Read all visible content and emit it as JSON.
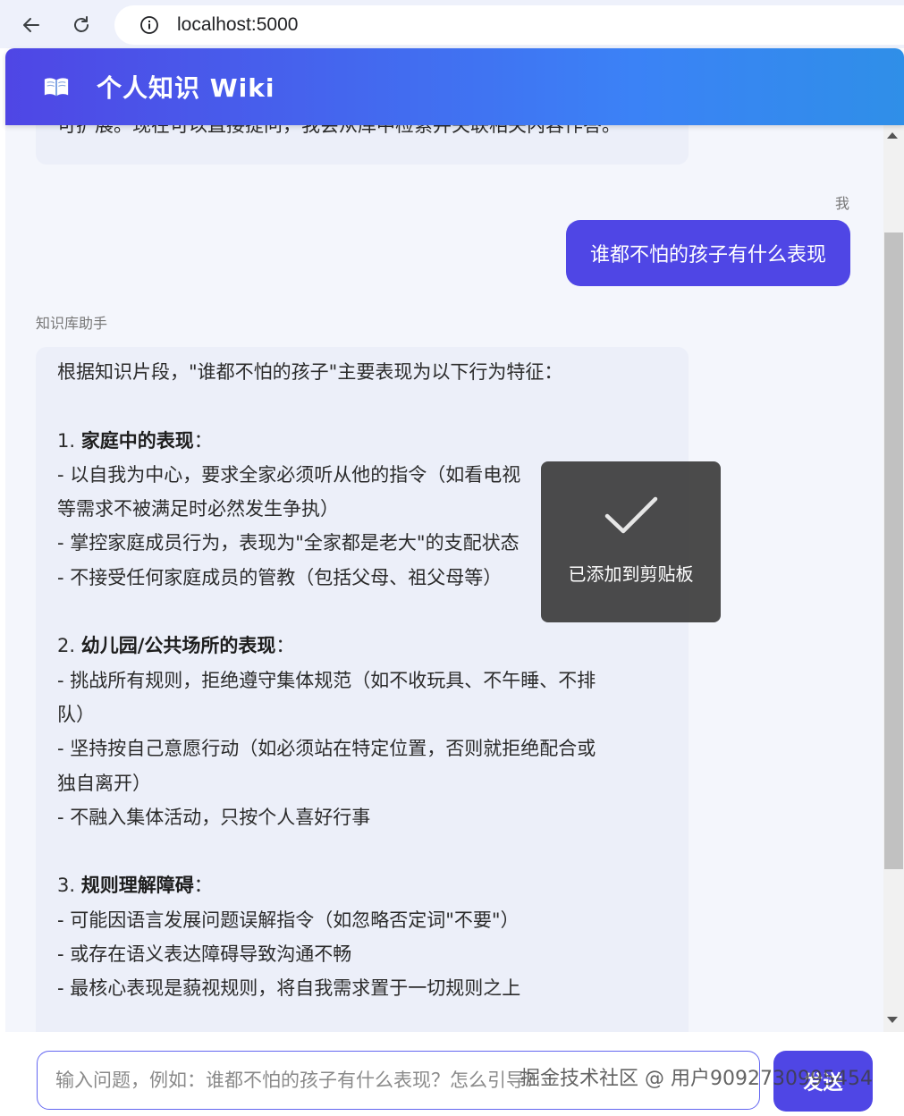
{
  "browser": {
    "url": "localhost:5000",
    "back_icon": "arrow-left-icon",
    "reload_icon": "reload-icon",
    "info_icon": "info-icon"
  },
  "header": {
    "icon": "book-icon",
    "title": "个人知识 Wiki"
  },
  "chat": {
    "previous_message_tail": "可扩展。现在可以直接提问，我会从库中检索并关联相关内容作答。",
    "user_sender": "我",
    "user_message": "谁都不怕的孩子有什么表现",
    "assistant_sender": "知识库助手",
    "answer_lines": [
      {
        "text": "根据知识片段，\"谁都不怕的孩子\"主要表现为以下行为特征：",
        "bold": ""
      },
      {
        "text": "",
        "bold": ""
      },
      {
        "prefix": "1. ",
        "bold": "家庭中的表现",
        "text": "："
      },
      {
        "text": "   - 以自我为中心，要求全家必须听从他的指令（如看电视",
        "bold": ""
      },
      {
        "text": "等需求不被满足时必然发生争执）",
        "bold": ""
      },
      {
        "text": "   - 掌控家庭成员行为，表现为\"全家都是老大\"的支配状态",
        "bold": ""
      },
      {
        "text": "   - 不接受任何家庭成员的管教（包括父母、祖父母等）",
        "bold": ""
      },
      {
        "text": "",
        "bold": ""
      },
      {
        "prefix": "2. ",
        "bold": "幼儿园/公共场所的表现",
        "text": "："
      },
      {
        "text": "   - 挑战所有规则，拒绝遵守集体规范（如不收玩具、不午睡、不排",
        "bold": ""
      },
      {
        "text": "队）",
        "bold": ""
      },
      {
        "text": "   - 坚持按自己意愿行动（如必须站在特定位置，否则就拒绝配合或",
        "bold": ""
      },
      {
        "text": "独自离开）",
        "bold": ""
      },
      {
        "text": "   - 不融入集体活动，只按个人喜好行事",
        "bold": ""
      },
      {
        "text": "",
        "bold": ""
      },
      {
        "prefix": "3. ",
        "bold": "规则理解障碍",
        "text": "："
      },
      {
        "text": "   - 可能因语言发展问题误解指令（如忽略否定词\"不要\"）",
        "bold": ""
      },
      {
        "text": "   - 或存在语义表达障碍导致沟通不畅",
        "bold": ""
      },
      {
        "text": "   - 最核心表现是藐视规则，将自我需求置于一切规则之上",
        "bold": ""
      }
    ]
  },
  "toast": {
    "icon": "checkmark-icon",
    "text": "已添加到剪贴板"
  },
  "input": {
    "placeholder": "输入问题，例如：谁都不怕的孩子有什么表现？怎么引导？",
    "send_label": "发送"
  },
  "watermark": "掘金技术社区 @ 用户9092730995454",
  "colors": {
    "accent": "#4f46e5",
    "header_gradient_end": "#2f8fe8",
    "assistant_bubble": "#eceff9",
    "chat_background": "#f4f6fc"
  }
}
